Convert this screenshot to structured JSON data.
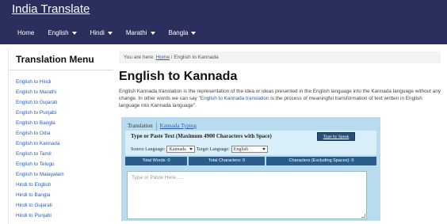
{
  "header": {
    "brand": "India Translate",
    "nav": [
      {
        "label": "Home",
        "dropdown": false
      },
      {
        "label": "English",
        "dropdown": true
      },
      {
        "label": "Hindi",
        "dropdown": true
      },
      {
        "label": "Marathi",
        "dropdown": true
      },
      {
        "label": "Bangla",
        "dropdown": true
      }
    ]
  },
  "sidebar": {
    "title": "Translation Menu",
    "items": [
      "English to Hindi",
      "English to Marathi",
      "English to Gujarati",
      "English to Punjabi",
      "English to Bangla",
      "English to Odia",
      "English to Kannada",
      "English to Tamil",
      "English to Telugu",
      "English to Malayalam",
      "Hindi to English",
      "Hindi to Bangla",
      "Hindi to Gujarati",
      "Hindi to Punjabi"
    ]
  },
  "breadcrumb": {
    "prefix": "You are here:",
    "home": "Home",
    "separator": "/",
    "current": "English to Kannada"
  },
  "main": {
    "title": "English to Kannada",
    "intro_part1": "English Kannada translation is the representation of the idea or ideas presented in the English language into the Kannada language without any change. In other words we can say \"",
    "intro_link": "English to Kannada translation",
    "intro_part2": " is the process of meaningful transformation of text written in English language into Kannada language\"."
  },
  "widget": {
    "tab_active": "Translation",
    "tab_inactive": "Kannada Typing",
    "header_title": "Type or Paste Text (Maximum 4900 Characters with Space)",
    "speak_button": "Type by Speak",
    "source_label": "Source Language:",
    "source_value": "Kannada",
    "target_label": "Target Language:",
    "target_value": "English",
    "stat_words": "Total Words: 0",
    "stat_chars": "Total Characters: 0",
    "stat_chars_no_space": "Characters (Excluding Spaces): 0",
    "textarea_placeholder": "Type or Paste Here....."
  },
  "colors": {
    "header_bg": "#2a2f5e",
    "widget_bg": "#b8dcee",
    "stat_bg": "#2a5d8a",
    "link": "#2a5db0"
  }
}
